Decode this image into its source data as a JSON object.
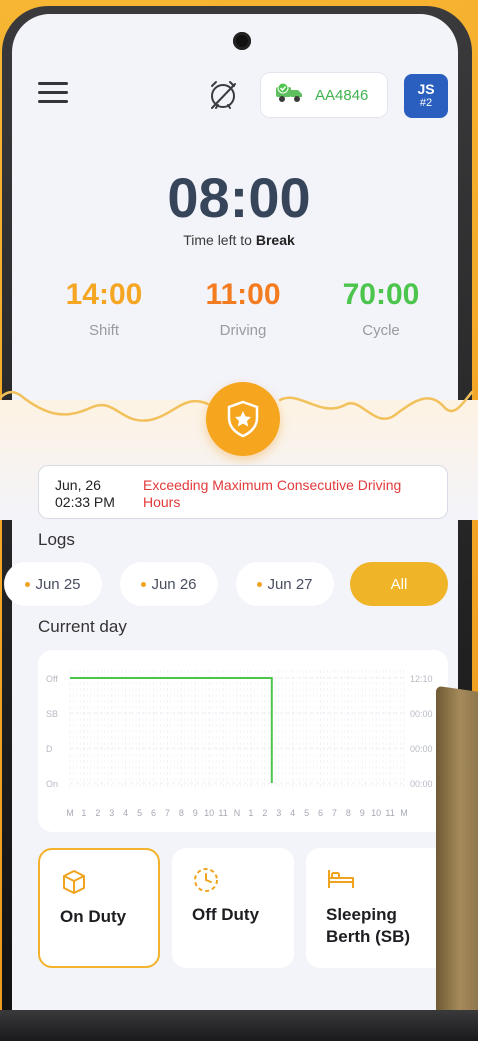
{
  "header": {
    "menu_icon": "hamburger-menu-icon",
    "alarm_icon": "alarm-clock-off-icon",
    "truck": {
      "icon": "truck-check-icon",
      "id": "AA4846"
    },
    "user": {
      "initials": "JS",
      "number": "#2"
    }
  },
  "timer": {
    "value": "08:00",
    "label_prefix": "Time left to",
    "label_target": "Break"
  },
  "stats": [
    {
      "value": "14:00",
      "label": "Shift",
      "color": "#f5a623"
    },
    {
      "value": "11:00",
      "label": "Driving",
      "color": "#f47c20"
    },
    {
      "value": "70:00",
      "label": "Cycle",
      "color": "#4cc54c"
    }
  ],
  "shield_icon": "shield-star-icon",
  "violation": {
    "date": "Jun, 26",
    "time": "02:33 PM",
    "message": "Exceeding Maximum Consecutive Driving Hours"
  },
  "logs": {
    "title": "Logs",
    "chips": [
      "Jun 25",
      "Jun 26",
      "Jun 27"
    ],
    "all_label": "All"
  },
  "current_day": {
    "title": "Current day",
    "rows": [
      "Off",
      "SB",
      "D",
      "On"
    ],
    "row_totals": [
      "12:10",
      "00:00",
      "00:00",
      "00:00"
    ],
    "hour_labels": [
      "M",
      "1",
      "2",
      "3",
      "4",
      "5",
      "6",
      "7",
      "8",
      "9",
      "10",
      "11",
      "N",
      "1",
      "2",
      "3",
      "4",
      "5",
      "6",
      "7",
      "8",
      "9",
      "10",
      "11",
      "M"
    ]
  },
  "status_buttons": [
    {
      "label_line1": "On Duty",
      "label_line2": "",
      "icon": "cube-icon",
      "active": true
    },
    {
      "label_line1": "Off Duty",
      "label_line2": "",
      "icon": "clock-dashed-icon",
      "active": false
    },
    {
      "label_line1": "Sleeping",
      "label_line2": "Berth (SB)",
      "icon": "bed-icon",
      "active": false
    }
  ],
  "colors": {
    "accent": "#f5a623",
    "green": "#4cc54c",
    "blue": "#2a5fbf",
    "red": "#e23a3a"
  }
}
